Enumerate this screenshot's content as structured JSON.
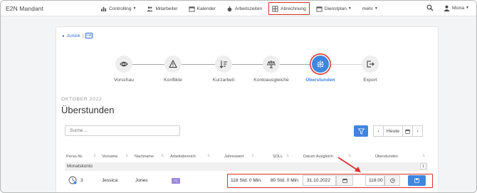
{
  "topbar": {
    "brand": "E2N Mandant",
    "nav": [
      {
        "label": "Controlling",
        "icon": "chart-icon",
        "dropdown": true
      },
      {
        "label": "Mitarbeiter",
        "icon": "people-icon",
        "dropdown": false
      },
      {
        "label": "Kalender",
        "icon": "calendar-icon",
        "dropdown": false
      },
      {
        "label": "Arbeitszeiten",
        "icon": "stopwatch-icon",
        "dropdown": false
      },
      {
        "label": "Abrechnung",
        "icon": "calculator-icon",
        "dropdown": false,
        "active": true
      },
      {
        "label": "Dienstplan",
        "icon": "calendar-icon",
        "dropdown": true
      },
      {
        "label": "mehr",
        "icon": "",
        "dropdown": true
      }
    ],
    "user": "Mona"
  },
  "back": {
    "label": "zurück",
    "tag": "ÜB"
  },
  "steps": [
    {
      "label": "Vorschau",
      "icon": "eye-icon"
    },
    {
      "label": "Konflikte",
      "icon": "warning-icon"
    },
    {
      "label": "Kurzarbeit",
      "icon": "sort-descending-icon"
    },
    {
      "label": "Kontoausgleiche",
      "icon": "scale-icon"
    },
    {
      "label": "Überstunden",
      "icon": "calculator-icon",
      "current": true
    },
    {
      "label": "Export",
      "icon": "export-icon"
    }
  ],
  "month": "OKTOBER 2022",
  "title": "Überstunden",
  "search": {
    "placeholder": "Suche ..."
  },
  "pager": {
    "today": "Heute"
  },
  "table": {
    "headers": [
      "Perso-Nr.",
      "Vorname",
      "Nachname",
      "Arbeitsbereich",
      "Jahreswert",
      "SOLL",
      "Datum Ausgleich",
      "Überstunden"
    ],
    "group": {
      "label": "Monatskonto",
      "count": "1"
    },
    "rows": [
      {
        "perso_nr": "3",
        "vorname": "Jessica",
        "nachname": "Jones",
        "bereich": "FC",
        "jahreswert": "118 Std. 0 Min.",
        "soll": "80 Std. 0 Min.",
        "datum": "31.10.2022",
        "zeit": "118:00"
      }
    ]
  },
  "colors": {
    "accent": "#3f86de",
    "highlight": "#d9302c",
    "badge": "#9b87d9"
  }
}
